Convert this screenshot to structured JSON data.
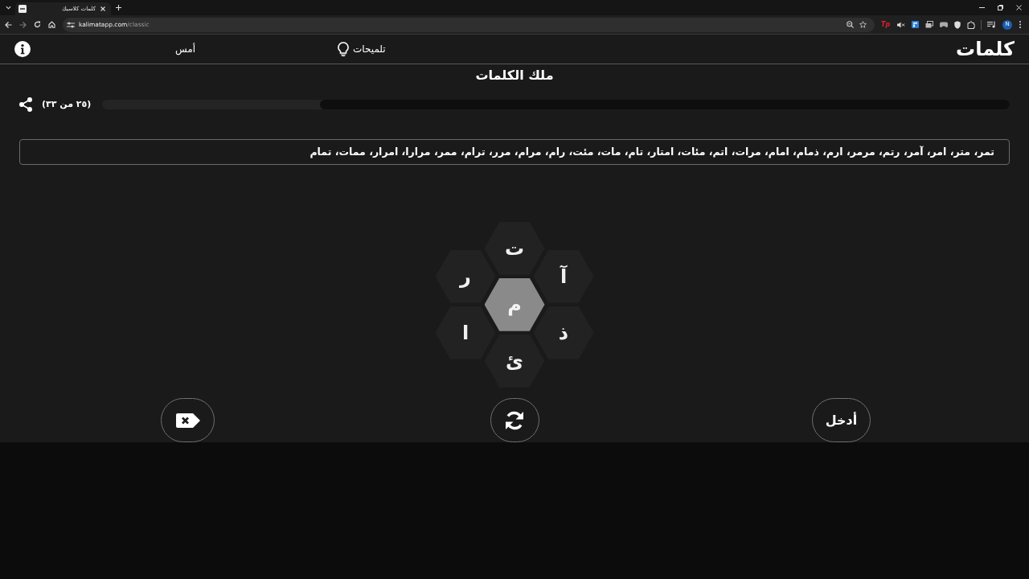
{
  "browser": {
    "tab": {
      "title": "كلمات كلاسيك"
    },
    "address": {
      "host": "kalimatapp.com",
      "path": "/classic"
    },
    "extension_label": "Tp",
    "profile_initial": "N"
  },
  "header": {
    "logo": "كلمات",
    "hints": "تلميحات",
    "yesterday": "أمس"
  },
  "title": "ملك الكلمات",
  "progress": {
    "count": "(٢٥ من ٣٣)",
    "level": 0.76
  },
  "found_words": "تمر، متر، امر، آمر، رتم، مرمر، ارم، ذمام، امام، مرات، اتم، مئات، امتار، تام، مات، مئت، رام، مرام، مرر، ترام، ممر، مرارا، امرار، ممات، تمام",
  "letters": {
    "center": "م",
    "outer": [
      "ت",
      "آ",
      "ذ",
      "ئ",
      "ا",
      "ر"
    ]
  },
  "enter_button": {
    "label": "أدخل"
  }
}
